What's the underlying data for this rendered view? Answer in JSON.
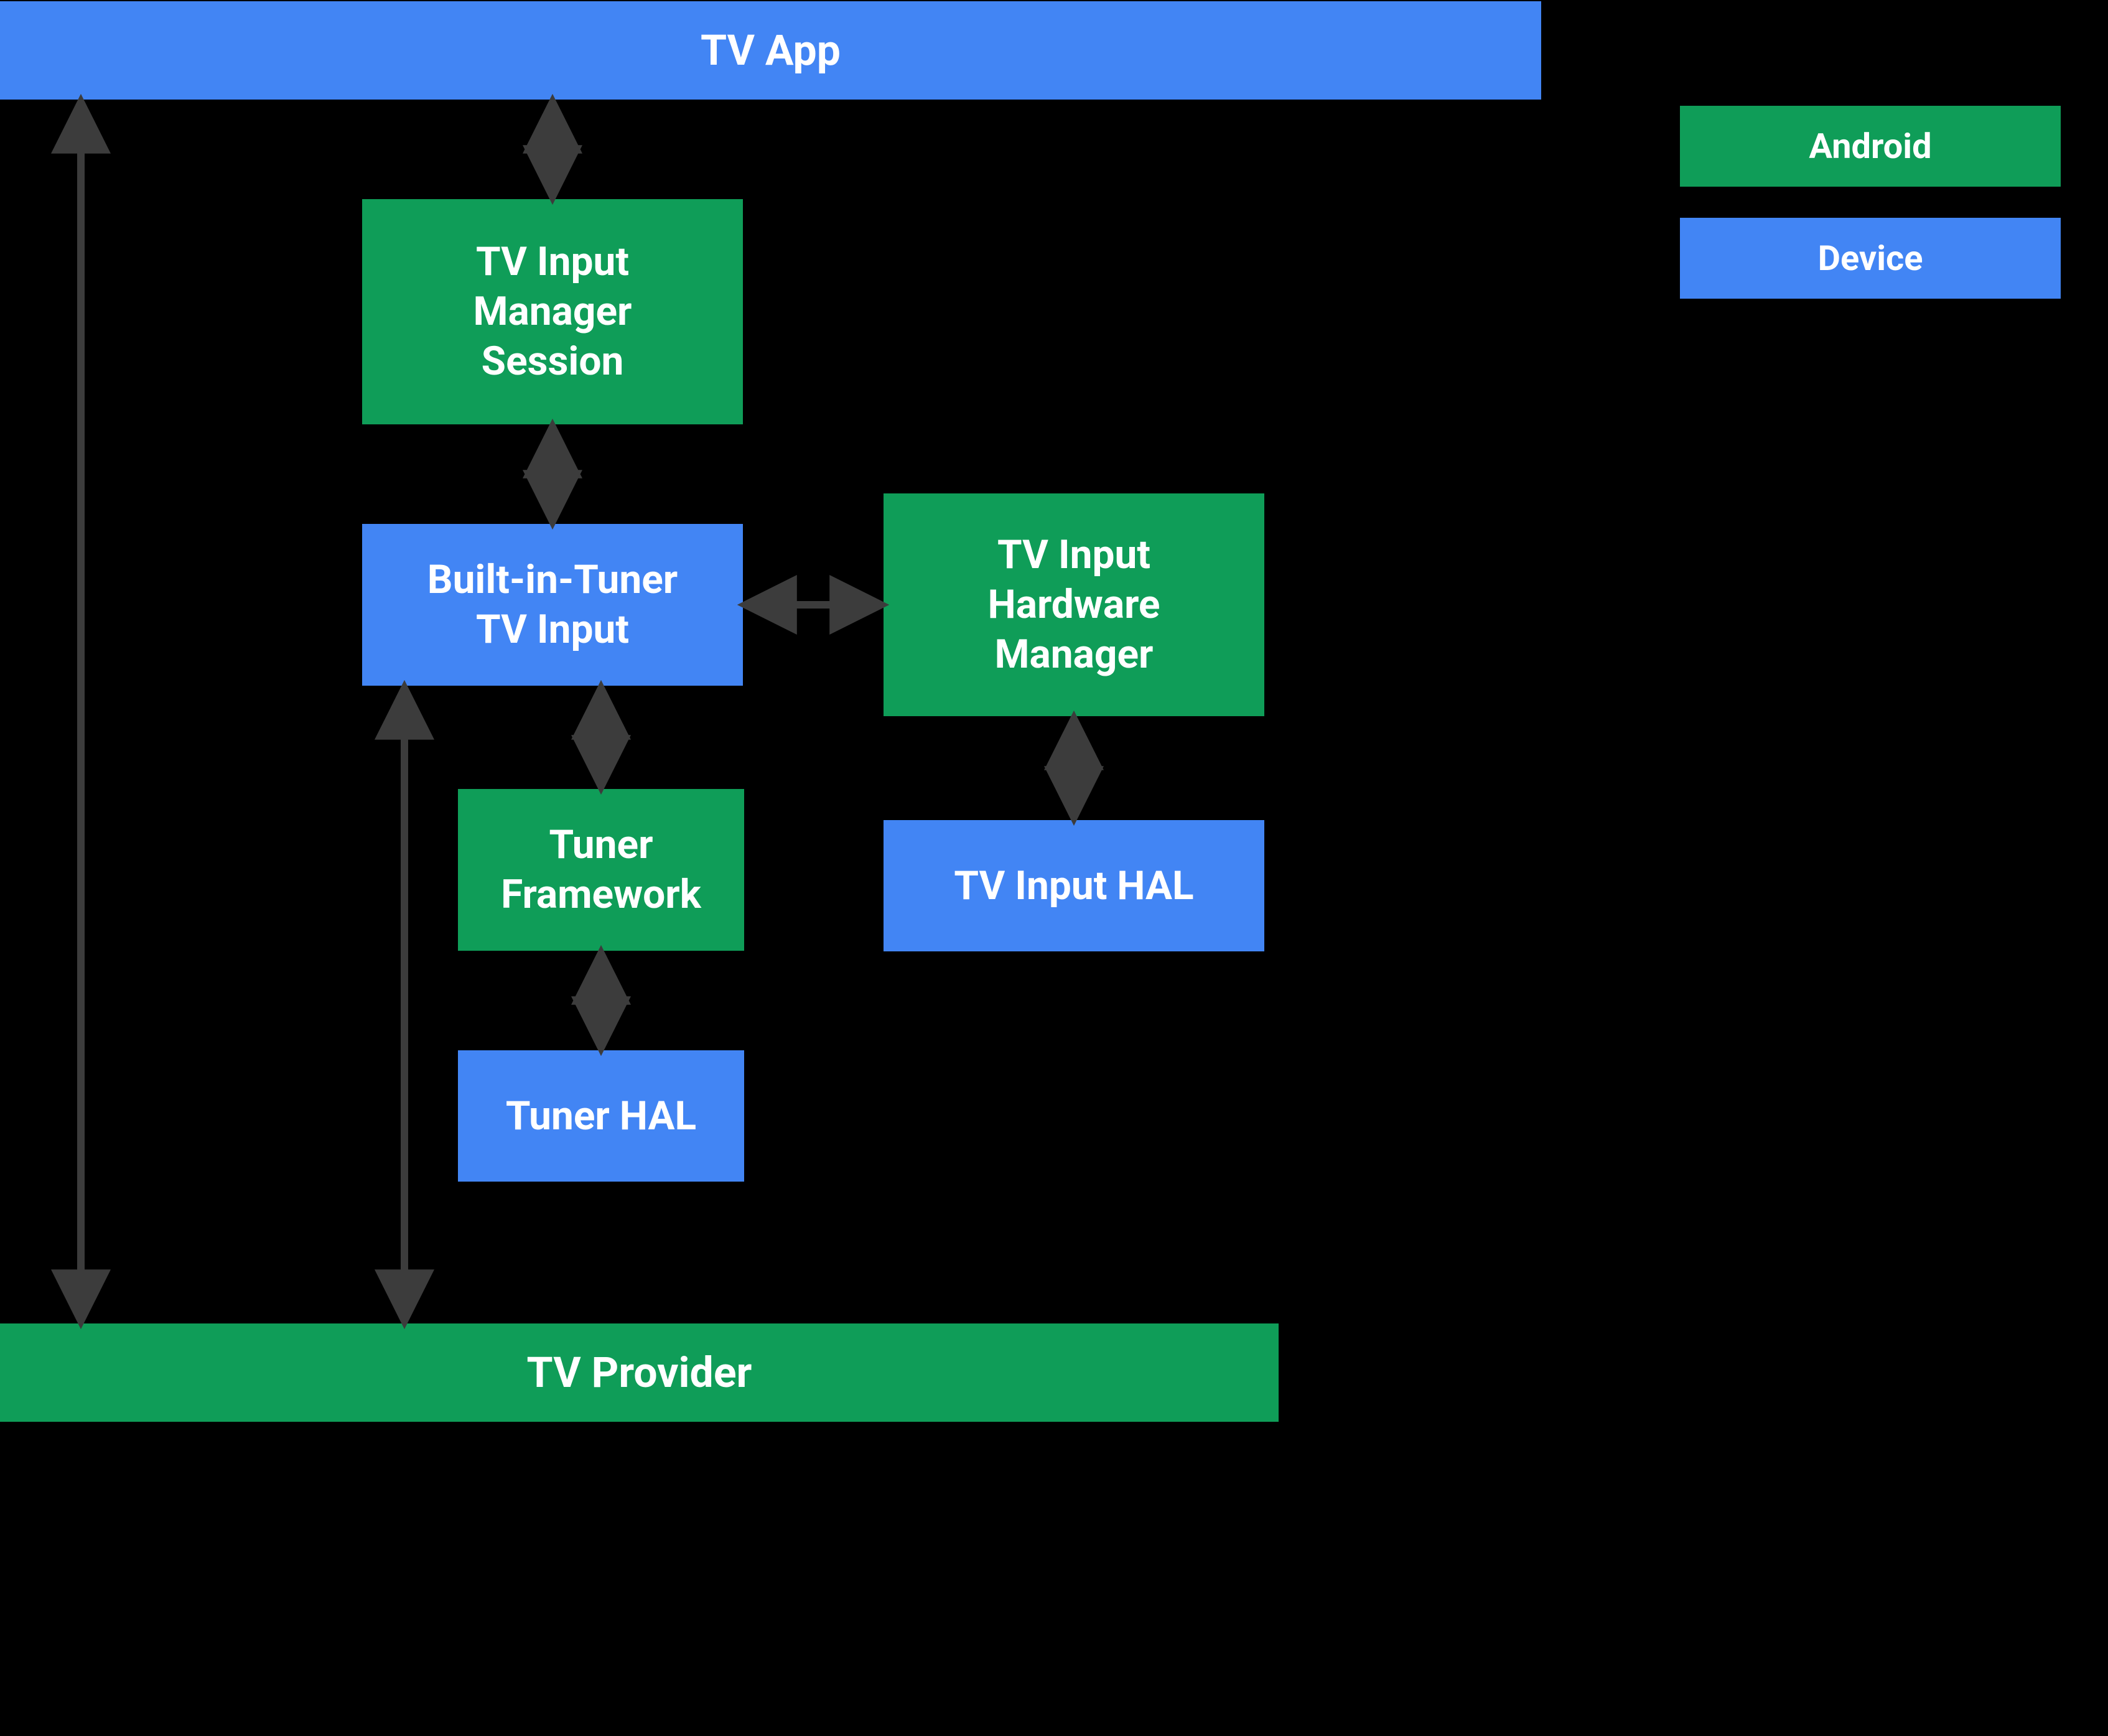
{
  "colors": {
    "android": "#0f9d58",
    "device": "#4285f4",
    "arrow": "#3c3c3c",
    "text": "#ffffff",
    "background": "#000000"
  },
  "boxes": {
    "tv_app": "TV App",
    "tv_input_manager_session": "TV Input\nManager\nSession",
    "built_in_tuner_tv_input": "Built-in-Tuner\nTV Input",
    "tv_input_hardware_manager": "TV Input\nHardware\nManager",
    "tuner_framework": "Tuner\nFramework",
    "tv_input_hal": "TV Input HAL",
    "tuner_hal": "Tuner HAL",
    "tv_provider": "TV Provider"
  },
  "legend": {
    "android": "Android",
    "device": "Device"
  },
  "box_types": {
    "tv_app": "device",
    "tv_input_manager_session": "android",
    "built_in_tuner_tv_input": "device",
    "tv_input_hardware_manager": "android",
    "tuner_framework": "android",
    "tv_input_hal": "device",
    "tuner_hal": "device",
    "tv_provider": "android"
  },
  "connectors": [
    {
      "from": "tv_app",
      "to": "tv_provider",
      "direction": "vertical",
      "bidirectional": true
    },
    {
      "from": "tv_app",
      "to": "tv_input_manager_session",
      "direction": "vertical",
      "bidirectional": true
    },
    {
      "from": "tv_input_manager_session",
      "to": "built_in_tuner_tv_input",
      "direction": "vertical",
      "bidirectional": true
    },
    {
      "from": "built_in_tuner_tv_input",
      "to": "tv_input_hardware_manager",
      "direction": "horizontal",
      "bidirectional": true
    },
    {
      "from": "built_in_tuner_tv_input",
      "to": "tuner_framework",
      "direction": "vertical",
      "bidirectional": true
    },
    {
      "from": "built_in_tuner_tv_input",
      "to": "tv_provider",
      "direction": "vertical",
      "bidirectional": true
    },
    {
      "from": "tuner_framework",
      "to": "tuner_hal",
      "direction": "vertical",
      "bidirectional": true
    },
    {
      "from": "tv_input_hardware_manager",
      "to": "tv_input_hal",
      "direction": "vertical",
      "bidirectional": true
    }
  ]
}
